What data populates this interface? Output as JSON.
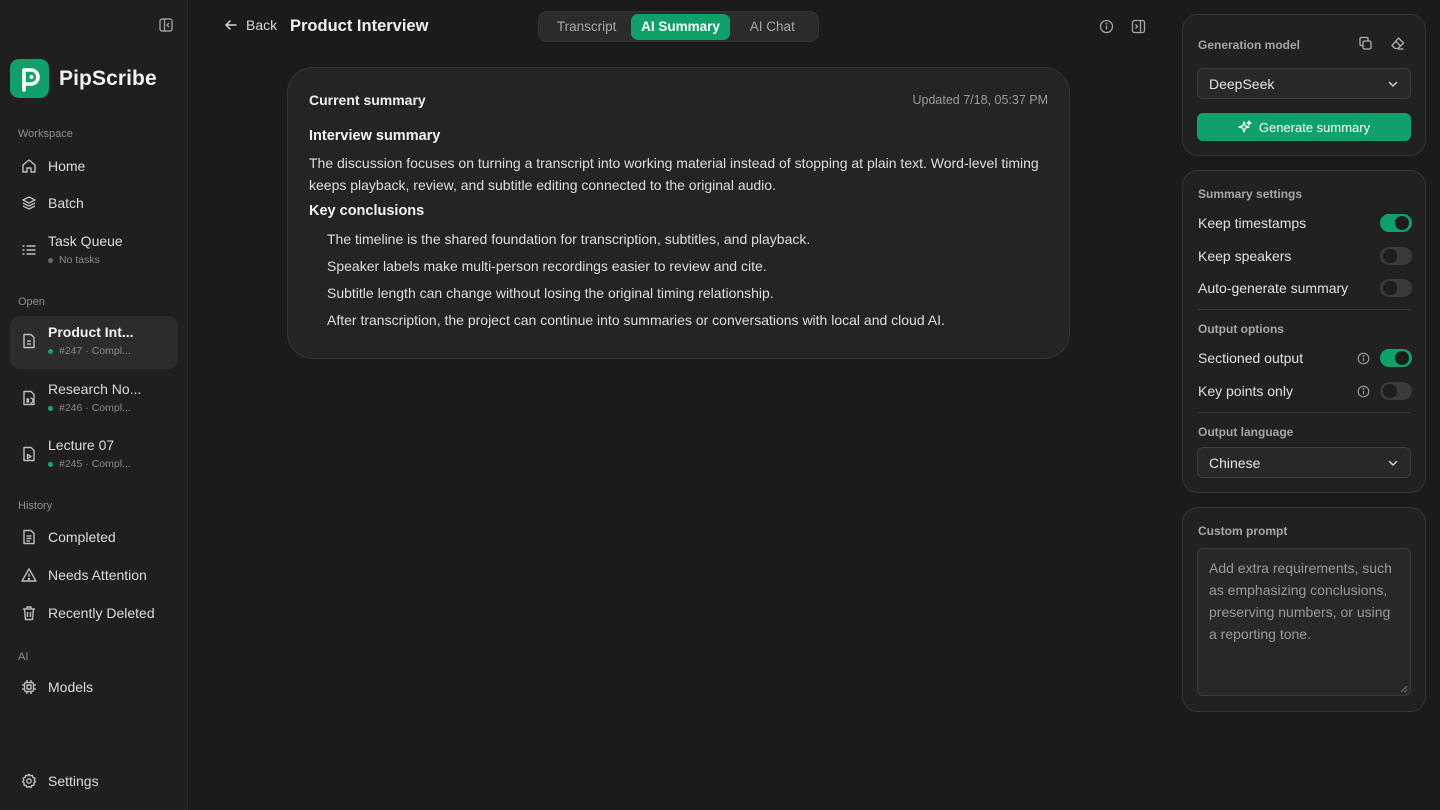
{
  "app": {
    "name": "PipScribe"
  },
  "sidebar": {
    "workspace_label": "Workspace",
    "workspace_items": [
      {
        "label": "Home",
        "icon": "home-icon"
      },
      {
        "label": "Batch",
        "icon": "layers-icon"
      },
      {
        "label": "Task Queue",
        "icon": "list-icon",
        "sub": "No tasks"
      }
    ],
    "open_label": "Open",
    "open_items": [
      {
        "label": "Product Int...",
        "sub": "#247 · Compl...",
        "icon": "file-icon",
        "active": true
      },
      {
        "label": "Research No...",
        "sub": "#246 · Compl...",
        "icon": "file-audio-icon"
      },
      {
        "label": "Lecture 07",
        "sub": "#245 · Compl...",
        "icon": "file-video-icon"
      }
    ],
    "history_label": "History",
    "history_items": [
      {
        "label": "Completed",
        "icon": "file-text-icon"
      },
      {
        "label": "Needs Attention",
        "icon": "alert-icon"
      },
      {
        "label": "Recently Deleted",
        "icon": "trash-icon"
      }
    ],
    "ai_label": "AI",
    "ai_items": [
      {
        "label": "Models",
        "icon": "chip-icon"
      }
    ],
    "settings_label": "Settings"
  },
  "header": {
    "back_label": "Back",
    "title": "Product Interview",
    "tabs": [
      {
        "label": "Transcript",
        "active": false
      },
      {
        "label": "AI Summary",
        "active": true
      },
      {
        "label": "AI Chat",
        "active": false
      }
    ]
  },
  "summary": {
    "heading": "Current summary",
    "updated": "Updated 7/18, 05:37 PM",
    "section_title": "Interview summary",
    "paragraph": "The discussion focuses on turning a transcript into working material instead of stopping at plain text. Word-level timing keeps playback, review, and subtitle editing connected to the original audio.",
    "conclusions_title": "Key conclusions",
    "conclusions": [
      "The timeline is the shared foundation for transcription, subtitles, and playback.",
      "Speaker labels make multi-person recordings easier to review and cite.",
      "Subtitle length can change without losing the original timing relationship.",
      "After transcription, the project can continue into summaries or conversations with local and cloud AI."
    ]
  },
  "panel": {
    "model_label": "Generation model",
    "model_value": "DeepSeek",
    "generate_label": "Generate summary",
    "settings_label": "Summary settings",
    "settings": [
      {
        "label": "Keep timestamps",
        "on": true
      },
      {
        "label": "Keep speakers",
        "on": false
      },
      {
        "label": "Auto-generate summary",
        "on": false
      }
    ],
    "output_label": "Output options",
    "outputs": [
      {
        "label": "Sectioned output",
        "on": true
      },
      {
        "label": "Key points only",
        "on": false
      }
    ],
    "language_label": "Output language",
    "language_value": "Chinese",
    "prompt_label": "Custom prompt",
    "prompt_placeholder": "Add extra requirements, such as emphasizing conclusions, preserving numbers, or using a reporting tone."
  },
  "colors": {
    "accent": "#10a06a",
    "background": "#1b1b1b",
    "panel": "#212121"
  }
}
